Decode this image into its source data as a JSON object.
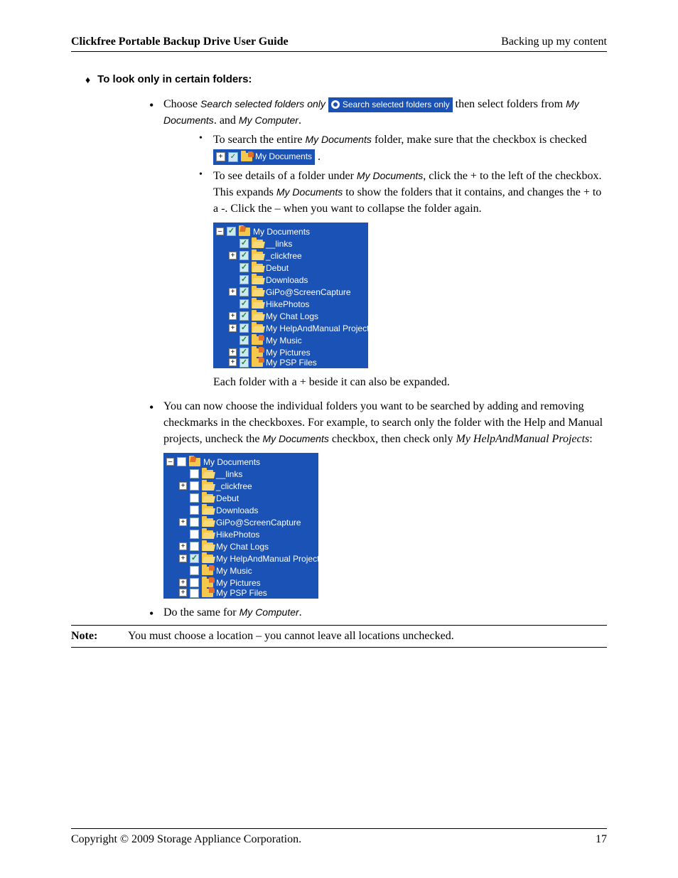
{
  "header": {
    "left": "Clickfree Portable Backup Drive User Guide",
    "right": "Backing up my content"
  },
  "section_title": "To look only in certain folders:",
  "bullet1": {
    "pre": "Choose ",
    "emph": "Search selected folders only",
    "ui_label": "Search selected folders only",
    "post1": " then select folders from ",
    "my_docs": "My Documents",
    "period_and": ". and ",
    "my_comp": "My Computer",
    "end": "."
  },
  "sub_a": {
    "pre": "To search the entire ",
    "emph": "My Documents",
    "mid": " folder, make sure that the checkbox is checked ",
    "ui_label": "My Documents",
    "end": " ."
  },
  "sub_b": {
    "pre": "To see details of a folder under ",
    "emph": "My Documents",
    "mid1": ", click the + to the left of the checkbox. This expands ",
    "emph2": "My Documents",
    "mid2": " to show the folders that it contains, and changes the + to a -. Click the – when you want to collapse the folder again."
  },
  "tree1": {
    "root": {
      "expander": "–",
      "checked": true,
      "special": true,
      "label": "My Documents"
    },
    "items": [
      {
        "expander": "",
        "checked": true,
        "label": "__links"
      },
      {
        "expander": "+",
        "checked": true,
        "label": "_clickfree"
      },
      {
        "expander": "",
        "checked": true,
        "label": "Debut"
      },
      {
        "expander": "",
        "checked": true,
        "label": "Downloads"
      },
      {
        "expander": "+",
        "checked": true,
        "label": "GiPo@ScreenCapture"
      },
      {
        "expander": "",
        "checked": true,
        "label": "HikePhotos"
      },
      {
        "expander": "+",
        "checked": true,
        "label": "My Chat Logs"
      },
      {
        "expander": "+",
        "checked": true,
        "label": "My HelpAndManual Projects"
      },
      {
        "expander": "",
        "checked": true,
        "label": "My Music",
        "special": true
      },
      {
        "expander": "+",
        "checked": true,
        "label": "My Pictures",
        "special": true
      },
      {
        "expander": "+",
        "checked": true,
        "label": "My PSP Files",
        "special": true
      }
    ]
  },
  "after_tree1": "Each folder with a + beside it can also be expanded.",
  "bullet2": {
    "pre": "You can now choose the individual folders you want to be searched by adding and removing checkmarks in the checkboxes. For example, to search only the folder with the Help and Manual projects, uncheck the ",
    "emph1": "My Documents",
    "mid": " checkbox, then check only ",
    "emph2": "My HelpAndManual Projects",
    "end": ":"
  },
  "tree2": {
    "root": {
      "expander": "–",
      "checked": false,
      "special": true,
      "label": "My Documents"
    },
    "items": [
      {
        "expander": "",
        "checked": false,
        "label": "__links"
      },
      {
        "expander": "+",
        "checked": false,
        "label": "_clickfree"
      },
      {
        "expander": "",
        "checked": false,
        "label": "Debut"
      },
      {
        "expander": "",
        "checked": false,
        "label": "Downloads"
      },
      {
        "expander": "+",
        "checked": false,
        "label": "GiPo@ScreenCapture"
      },
      {
        "expander": "",
        "checked": false,
        "label": "HikePhotos"
      },
      {
        "expander": "+",
        "checked": false,
        "label": "My Chat Logs"
      },
      {
        "expander": "+",
        "checked": true,
        "label": "My HelpAndManual Projects"
      },
      {
        "expander": "",
        "checked": false,
        "label": "My Music",
        "special": true
      },
      {
        "expander": "+",
        "checked": false,
        "label": "My Pictures",
        "special": true
      },
      {
        "expander": "+",
        "checked": false,
        "label": "My PSP Files",
        "special": true
      }
    ]
  },
  "bullet3": {
    "pre": "Do the same for ",
    "emph": "My Computer",
    "end": "."
  },
  "note": {
    "label": "Note",
    "text": "You must choose a location – you cannot leave all locations unchecked."
  },
  "footer": {
    "copyright": "Copyright © 2009  Storage Appliance Corporation.",
    "page": "17"
  }
}
